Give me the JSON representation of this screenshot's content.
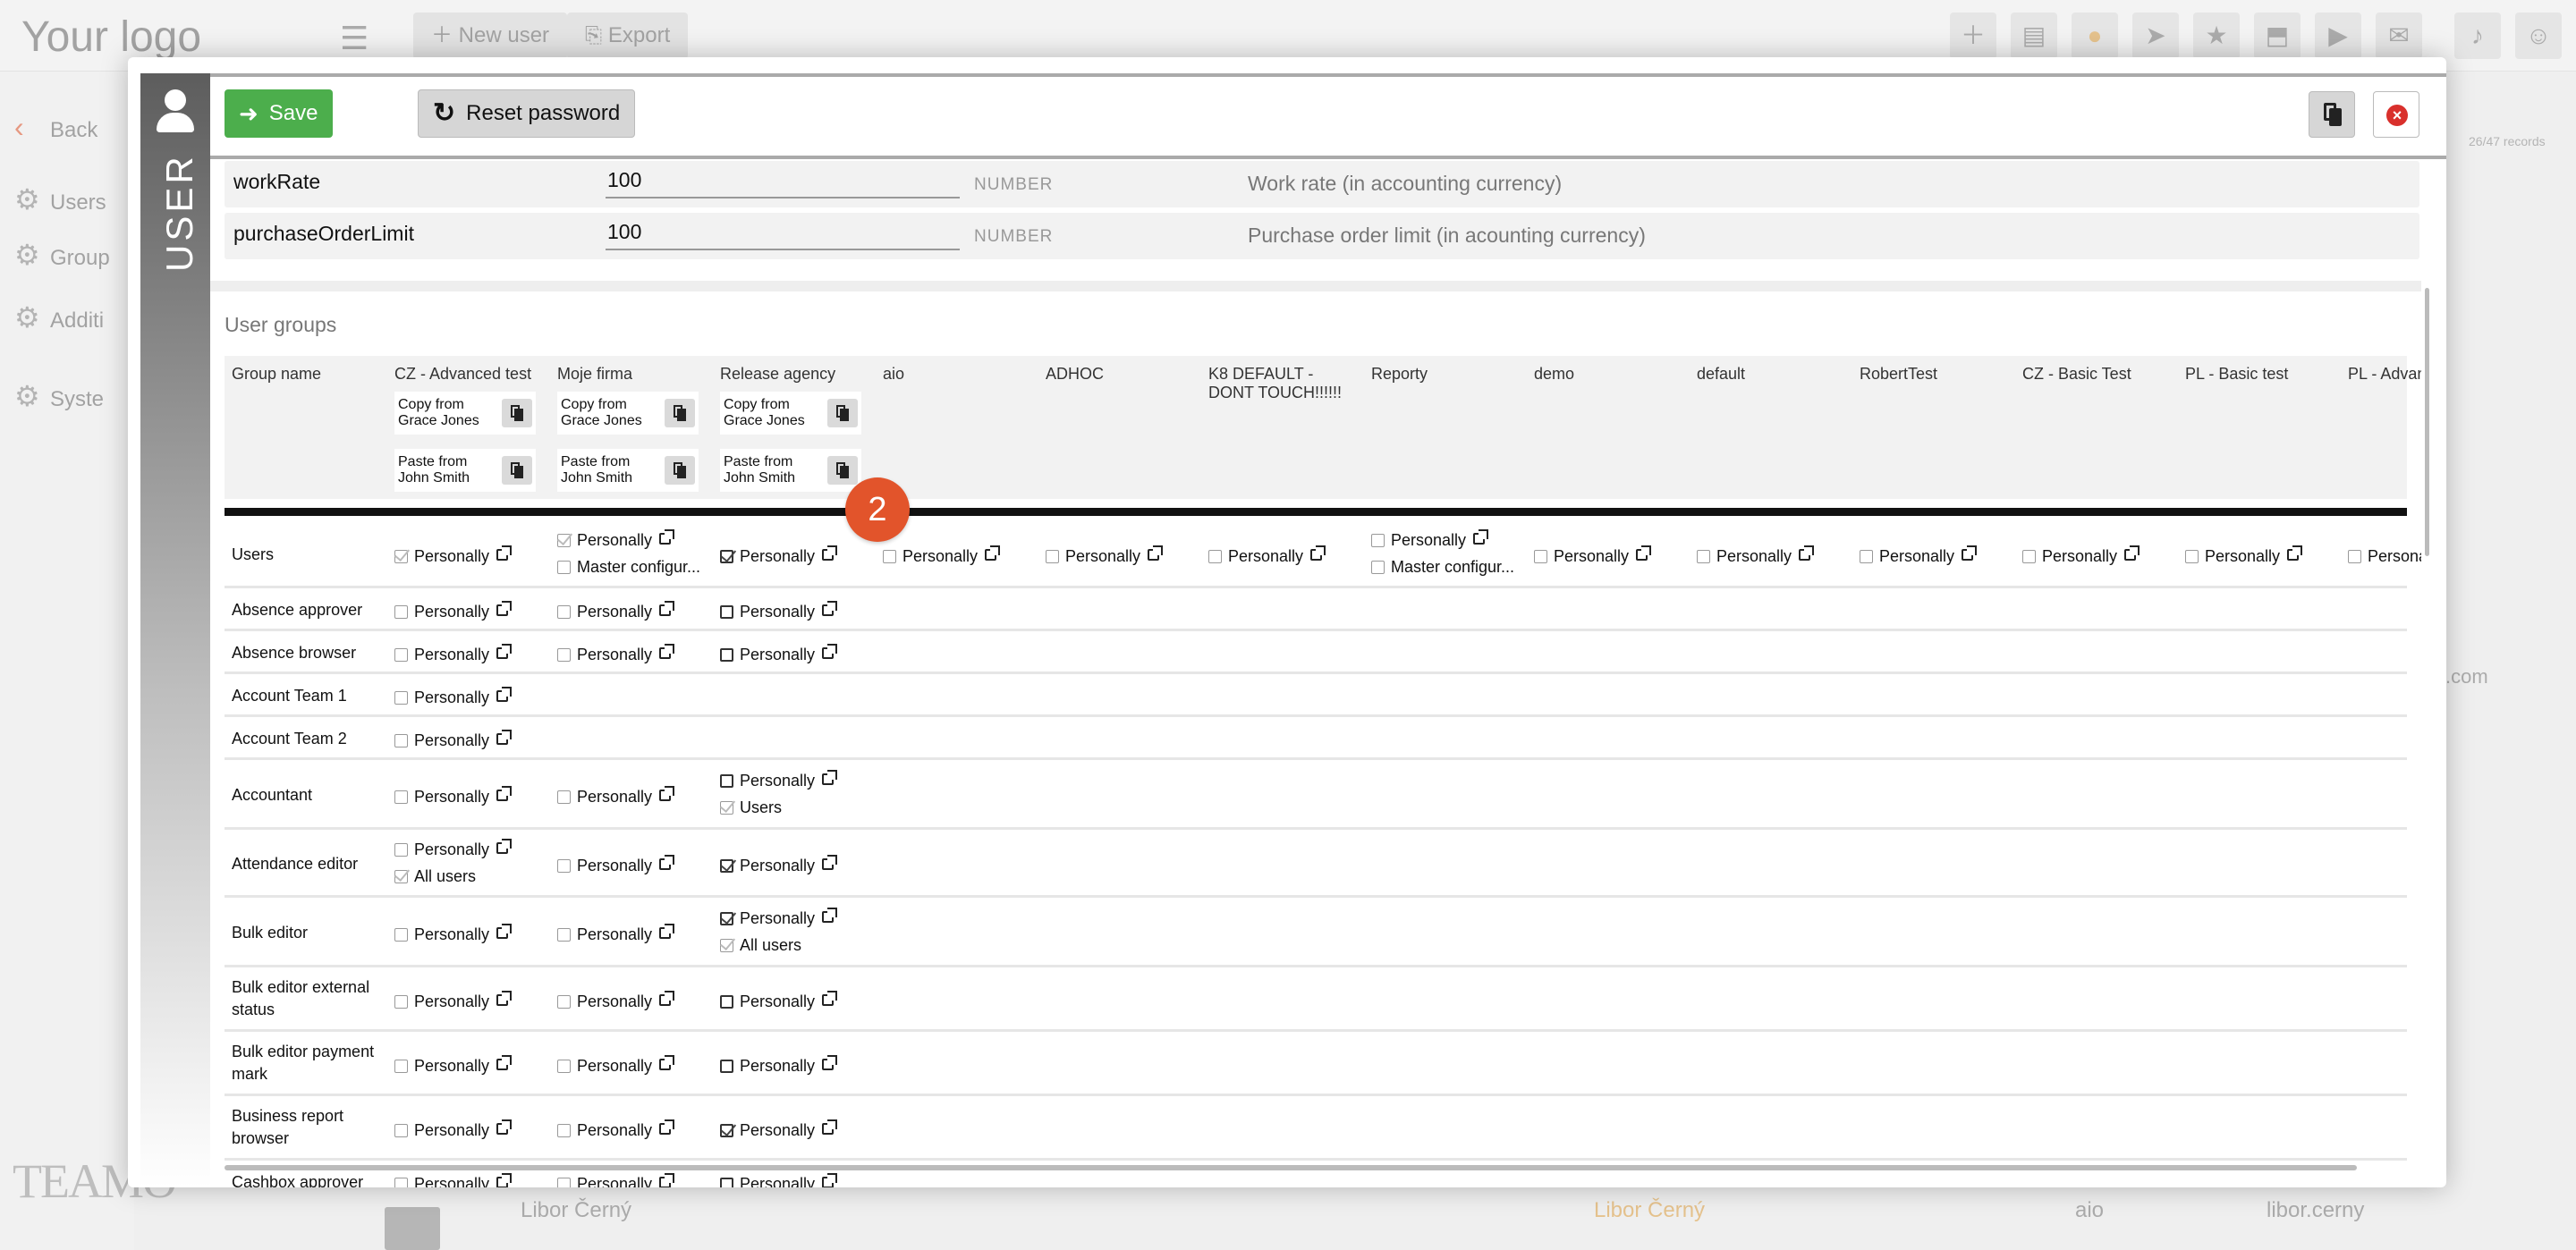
{
  "background": {
    "logo": "Your logo",
    "header_buttons": [
      "New user",
      "Export"
    ],
    "back_label": "Back",
    "sidebar_items": [
      "Users",
      "Group",
      "Additi",
      "Syste"
    ],
    "records_text": "26/47 records",
    "domain_fragment": ".com",
    "footer_row": {
      "name": "Libor Černý",
      "owner": "Libor Černý",
      "group": "aio",
      "login": "libor.cerny"
    },
    "bottom_logo": "TEAMO",
    "header_icons": [
      "plus-icon",
      "note-icon",
      "help-icon",
      "send-icon",
      "star-icon",
      "inbox-icon",
      "video-icon",
      "chat-icon",
      "bell-icon",
      "avatar-icon"
    ]
  },
  "modal": {
    "section_label": "USER",
    "toolbar": {
      "save_label": "Save",
      "reset_label": "Reset password"
    },
    "properties": [
      {
        "name": "workRate",
        "value": "100",
        "type": "NUMBER",
        "description": "Work rate (in accounting currency)"
      },
      {
        "name": "purchaseOrderLimit",
        "value": "100",
        "type": "NUMBER",
        "description": "Purchase order limit (in acounting currency)"
      }
    ],
    "user_groups": {
      "title": "User groups",
      "group_name_header": "Group name",
      "columns": [
        "CZ - Advanced test",
        "Moje firma",
        "Release agency",
        "aio",
        "ADHOC",
        "K8 DEFAULT - DONT TOUCH!!!!!!",
        "Reporty",
        "demo",
        "default",
        "RobertTest",
        "CZ - Basic Test",
        "PL - Basic test",
        "PL - Advance"
      ],
      "copy_from_label": "Copy from Grace Jones",
      "paste_from_label": "Paste from John Smith",
      "badge": "2",
      "option_labels": {
        "personally": "Personally",
        "master": "Master configur...",
        "users": "Users",
        "all_users": "All users"
      },
      "rows": [
        "Users",
        "Absence approver",
        "Absence browser",
        "Account Team 1",
        "Account Team 2",
        "Accountant",
        "Attendance editor",
        "Bulk editor",
        "Bulk editor external status",
        "Bulk editor payment mark",
        "Business report browser",
        "Cashbox approver"
      ]
    }
  },
  "colors": {
    "save": "#4cae4c",
    "badge": "#e2542b",
    "close": "#d9302c"
  }
}
